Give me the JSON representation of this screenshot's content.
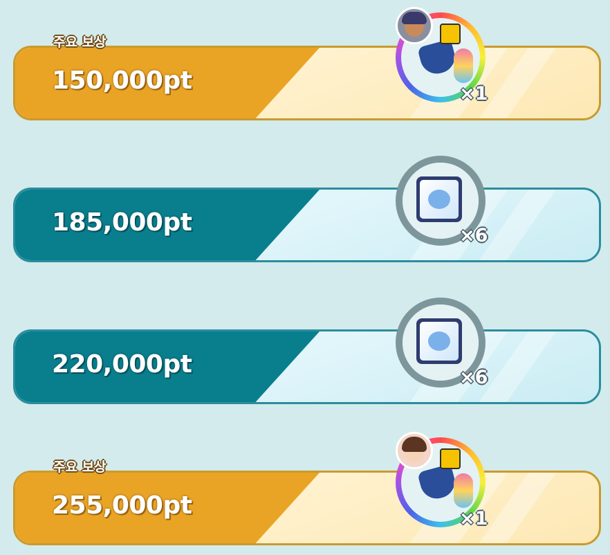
{
  "rows": [
    {
      "tag": "주요 보상",
      "points": "150,000pt",
      "multiplier": "×1",
      "theme": "gold",
      "reward": "outfit-bundle"
    },
    {
      "tag": "",
      "points": "185,000pt",
      "multiplier": "×6",
      "theme": "teal",
      "reward": "ticket"
    },
    {
      "tag": "",
      "points": "220,000pt",
      "multiplier": "×6",
      "theme": "teal",
      "reward": "ticket"
    },
    {
      "tag": "주요 보상",
      "points": "255,000pt",
      "multiplier": "×1",
      "theme": "gold",
      "reward": "outfit-bundle"
    }
  ],
  "colors": {
    "gold": "#eaa425",
    "teal": "#097f8e",
    "background": "#d3ebec"
  }
}
